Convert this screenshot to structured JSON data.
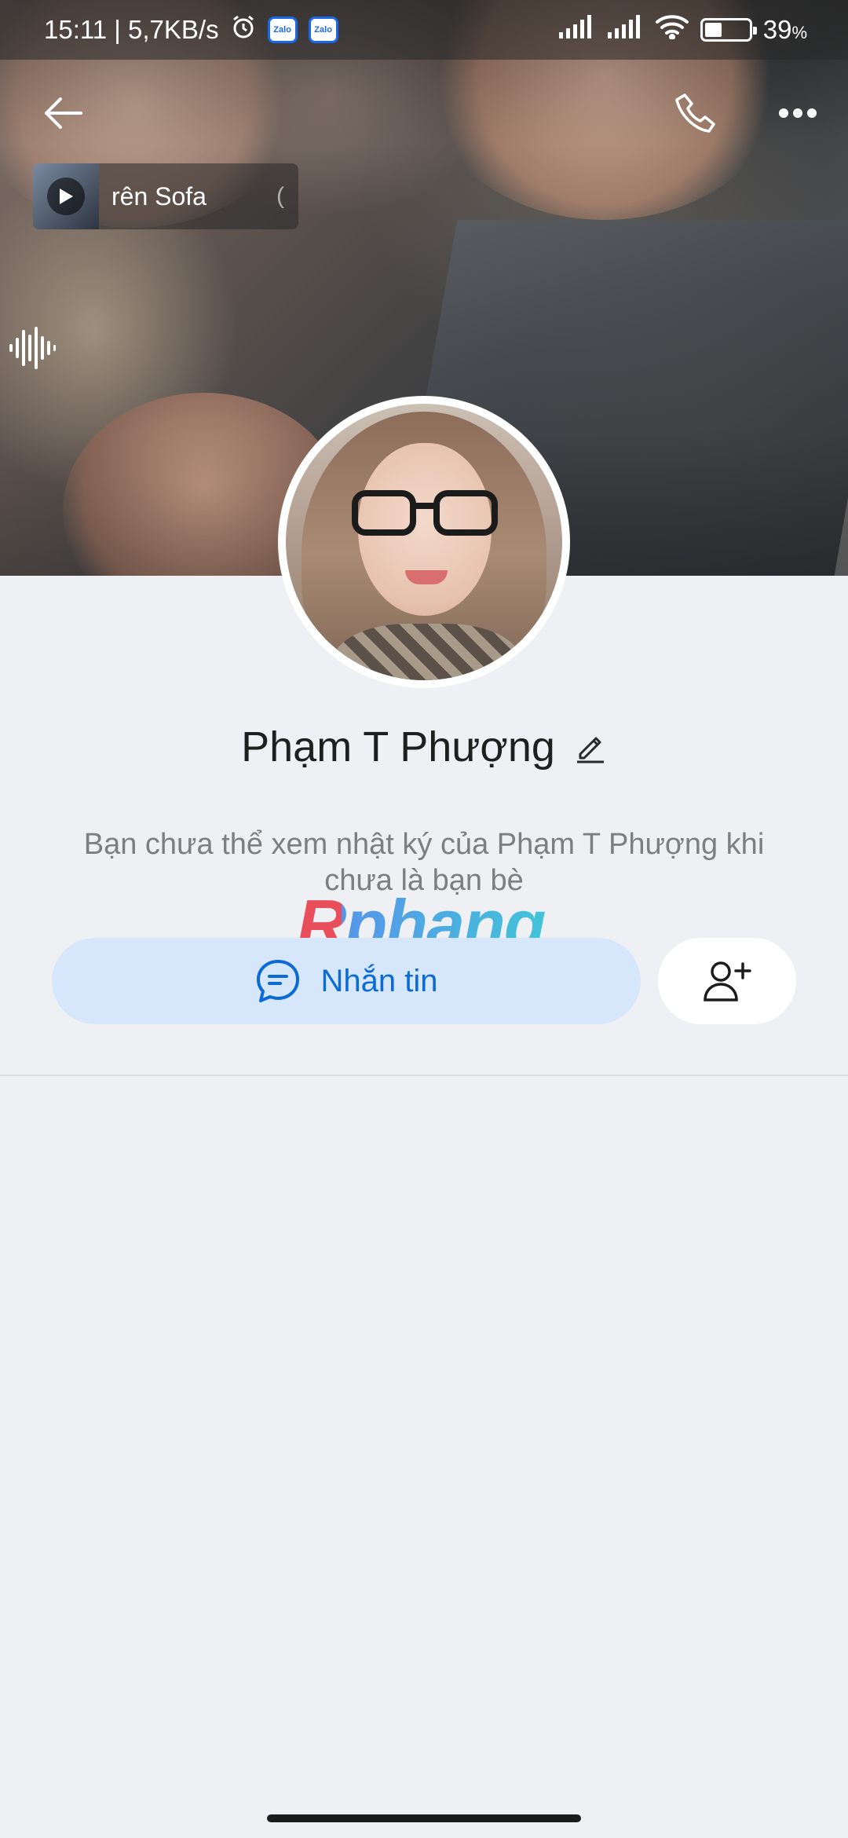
{
  "status_bar": {
    "time_speed": "15:11 | 5,7KB/s",
    "zalo_badge_1": "Zalo",
    "zalo_badge_2": "Zalo",
    "battery_percent": "39",
    "battery_sign": "%",
    "battery_level": 0.39,
    "icons": [
      "alarm-icon",
      "signal-icon",
      "signal-icon",
      "wifi-icon",
      "battery-icon"
    ]
  },
  "header": {
    "icons": [
      "back-arrow-icon",
      "phone-icon",
      "more-dots-icon"
    ]
  },
  "music": {
    "title": "rên Sofa",
    "trailing": "(",
    "icons": [
      "play-icon"
    ]
  },
  "profile": {
    "name": "Phạm T Phượng",
    "notice": "Bạn chưa thể xem nhật ký của Phạm T Phượng khi chưa là bạn bè"
  },
  "watermark": "Rphang",
  "actions": {
    "message_label": "Nhắn tin",
    "icons": [
      "chat-bubble-icon",
      "add-friend-icon"
    ]
  },
  "colors": {
    "accent": "#0b6bd4",
    "message_button_bg": "#d6e6fb",
    "page_bg": "#eff0f4"
  }
}
